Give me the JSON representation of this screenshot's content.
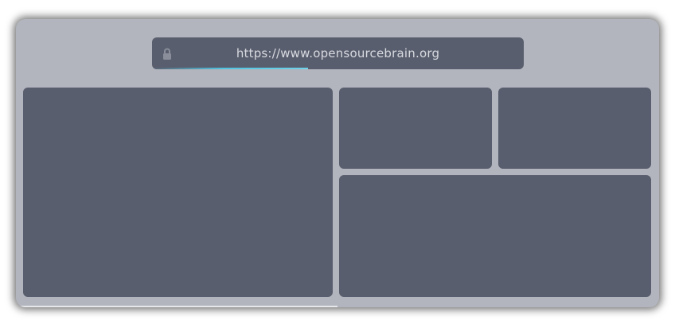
{
  "browser": {
    "url": "https://www.opensourcebrain.org",
    "secure_icon": "lock-icon",
    "load_progress": 0.42,
    "colors": {
      "window_bg": "#b2b5bd",
      "panel_bg": "#595e6e",
      "urlbar_bg": "#595e6e",
      "url_text": "#d8dae0",
      "progress_accent": "#4fc3e0"
    }
  },
  "panels": [
    {
      "name": "panel-main-left"
    },
    {
      "name": "panel-top-right-1"
    },
    {
      "name": "panel-top-right-2"
    },
    {
      "name": "panel-bottom-right"
    }
  ]
}
